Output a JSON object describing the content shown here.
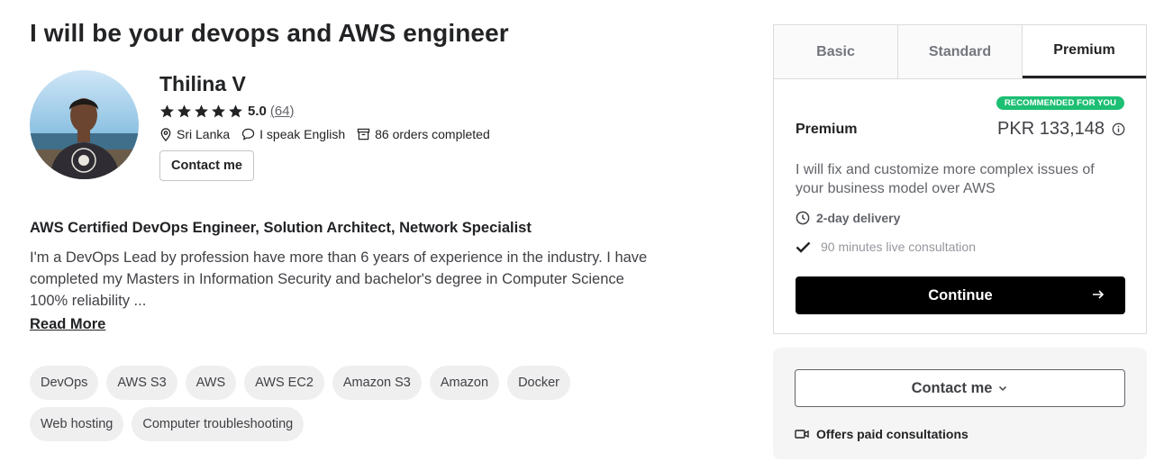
{
  "gig": {
    "title": "I will be your devops and AWS engineer",
    "headline": "AWS Certified DevOps Engineer, Solution Architect, Network Specialist",
    "description": "I'm a DevOps Lead by profession have more than 6 years of experience in the industry. I have completed my Masters in Information Security and bachelor's degree in Computer Science 100% reliability ...",
    "read_more": "Read More"
  },
  "seller": {
    "name": "Thilina V",
    "rating": "5.0",
    "rating_stars": 5,
    "reviews": "(64)",
    "location": "Sri Lanka",
    "language": "I speak English",
    "orders": "86 orders completed",
    "contact_label": "Contact me",
    "avatar_icon": "seller-photo"
  },
  "tags": {
    "row1": [
      "DevOps",
      "AWS S3",
      "AWS",
      "AWS EC2",
      "Amazon S3",
      "Amazon",
      "Docker"
    ],
    "row2": [
      "Web hosting",
      "Computer troubleshooting"
    ]
  },
  "package_panel": {
    "tabs": [
      "Basic",
      "Standard",
      "Premium"
    ],
    "active_tab": "Premium",
    "badge": "RECOMMENDED FOR YOU",
    "package_name": "Premium",
    "price": "PKR 133,148",
    "description": "I will fix and customize more complex issues of your business model over AWS",
    "delivery": "2-day delivery",
    "feature": "90 minutes live consultation",
    "continue_label": "Continue"
  },
  "contact_panel": {
    "contact_label": "Contact me",
    "offers": "Offers paid consultations"
  },
  "colors": {
    "accent_green": "#1dbf73",
    "button_black": "#000000",
    "text_dark": "#222325"
  }
}
